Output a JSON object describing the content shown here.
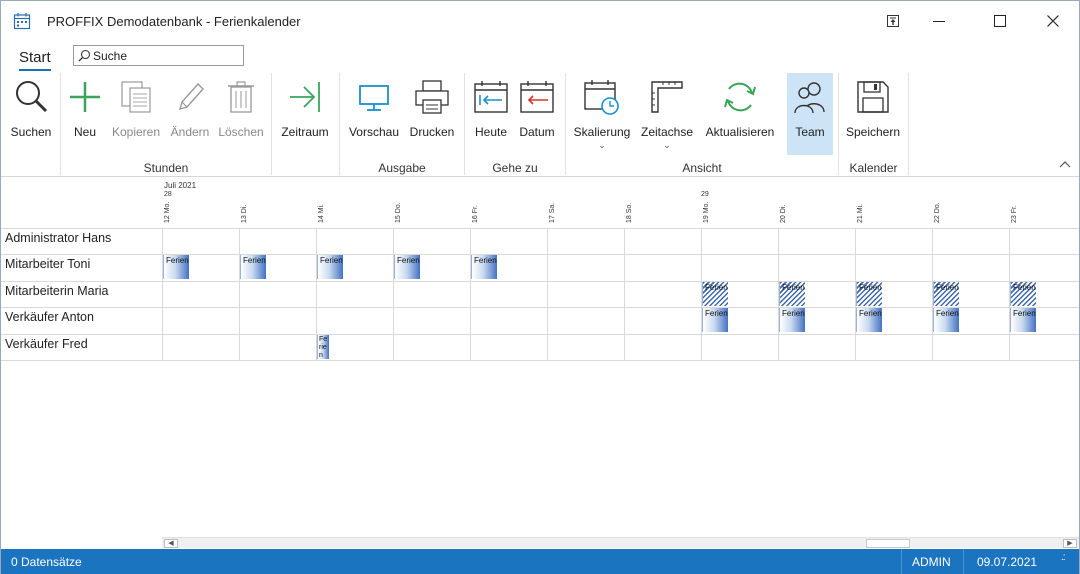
{
  "window": {
    "title": "PROFFIX Demodatenbank - Ferienkalender"
  },
  "tabs": {
    "start": "Start"
  },
  "search": {
    "placeholder": "Suche"
  },
  "ribbon": {
    "buttons": {
      "suchen": "Suchen",
      "neu": "Neu",
      "kopieren": "Kopieren",
      "aendern": "Ändern",
      "loeschen": "Löschen",
      "zeitraum": "Zeitraum",
      "vorschau": "Vorschau",
      "drucken": "Drucken",
      "heute": "Heute",
      "datum": "Datum",
      "skalierung": "Skalierung",
      "zeitachse": "Zeitachse",
      "aktualisieren": "Aktualisieren",
      "team": "Team",
      "speichern": "Speichern"
    },
    "groups": {
      "stunden": "Stunden",
      "ausgabe": "Ausgabe",
      "gehe_zu": "Gehe zu",
      "ansicht": "Ansicht",
      "kalender": "Kalender"
    }
  },
  "calendar": {
    "month_label": "Juli 2021",
    "week_labels": [
      "28",
      "29"
    ],
    "days": [
      "12 Mo.",
      "13 Di.",
      "14 Mi.",
      "15 Do.",
      "16 Fr.",
      "17 Sa.",
      "18 So.",
      "19 Mo.",
      "20 Di.",
      "21 Mi.",
      "22 Do.",
      "23 Fr."
    ],
    "rows": [
      "Administrator Hans",
      "Mitarbeiter Toni",
      "Mitarbeiterin Maria",
      "Verkäufer Anton",
      "Verkäufer Fred"
    ],
    "event_label": "Ferien",
    "event_label_narrow": "Fe rie n",
    "events": [
      {
        "row": 1,
        "day": 0,
        "style": "solid"
      },
      {
        "row": 1,
        "day": 1,
        "style": "solid"
      },
      {
        "row": 1,
        "day": 2,
        "style": "solid"
      },
      {
        "row": 1,
        "day": 3,
        "style": "solid"
      },
      {
        "row": 1,
        "day": 4,
        "style": "solid"
      },
      {
        "row": 2,
        "day": 7,
        "style": "hatched"
      },
      {
        "row": 2,
        "day": 8,
        "style": "hatched"
      },
      {
        "row": 2,
        "day": 9,
        "style": "hatched"
      },
      {
        "row": 2,
        "day": 10,
        "style": "hatched"
      },
      {
        "row": 2,
        "day": 11,
        "style": "hatched"
      },
      {
        "row": 3,
        "day": 7,
        "style": "solid"
      },
      {
        "row": 3,
        "day": 8,
        "style": "solid"
      },
      {
        "row": 3,
        "day": 9,
        "style": "solid"
      },
      {
        "row": 3,
        "day": 10,
        "style": "solid"
      },
      {
        "row": 3,
        "day": 11,
        "style": "solid"
      },
      {
        "row": 4,
        "day": 2,
        "style": "narrow"
      }
    ]
  },
  "statusbar": {
    "records": "0 Datensätze",
    "user": "ADMIN",
    "date": "09.07.2021"
  },
  "colors": {
    "accent": "#1b74c0",
    "active_button": "#cde4f6",
    "event_blue": "#4472c4"
  }
}
